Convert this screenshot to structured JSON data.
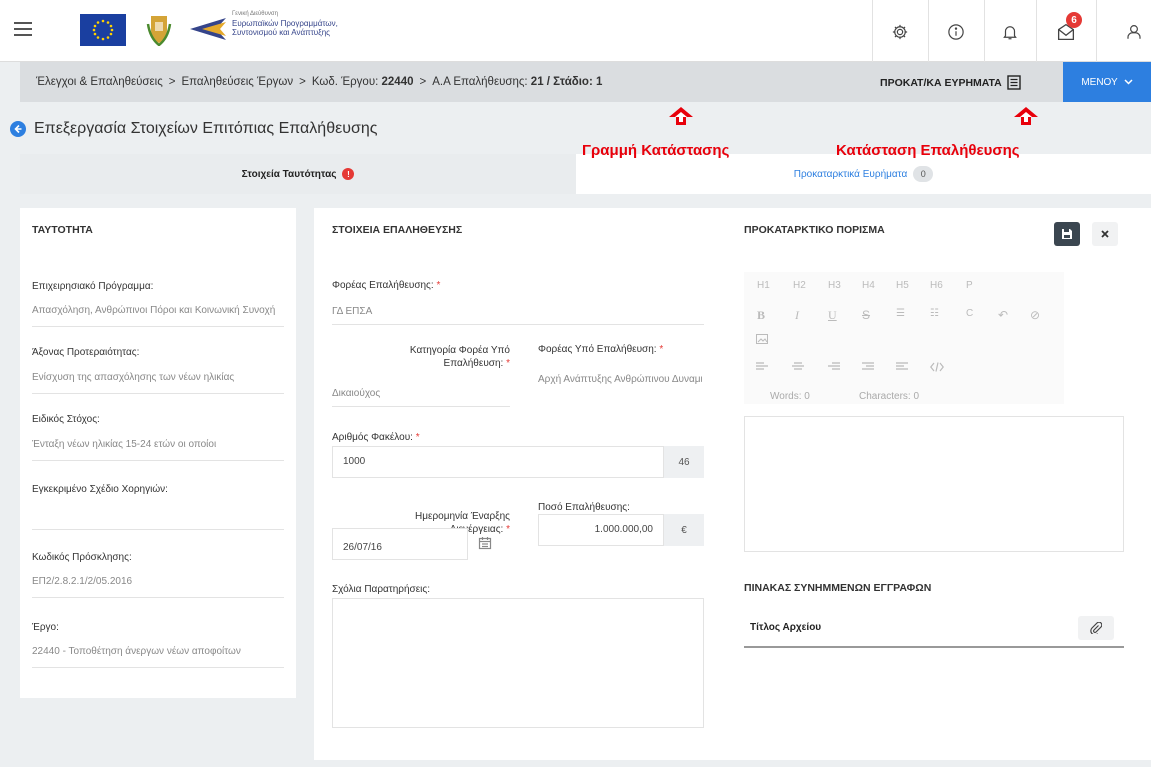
{
  "header": {
    "logo_text_line1": "Γενική Διεύθυνση",
    "logo_text_line2": "Ευρωπαϊκών Προγραμμάτων,",
    "logo_text_line3": "Συντονισμού και Ανάπτυξης",
    "mail_count": "6",
    "icons": [
      "gear-icon",
      "info-icon",
      "bell-icon",
      "mail-icon",
      "user-icon"
    ]
  },
  "breadcrumb": {
    "c1": "Έλεγχοι & Επαληθεύσεις",
    "c2": "Επαληθεύσεις Έργων",
    "c3_label": "Κωδ. Έργου:",
    "c3_value": "22440",
    "c4_label": "Α.Α Επαλήθευσης:",
    "c4_value": "21 / Στάδιο: 1",
    "separator": ">",
    "prelim_label": "ΠΡΟΚΑΤ/ΚΑ ΕΥΡΗΜΑΤΑ",
    "menu_label": "ΜΕΝΟΥ"
  },
  "page": {
    "title": "Επεξεργασία Στοιχείων Επιτόπιας Επαλήθευσης"
  },
  "annotations": {
    "status_line": "Γραμμή Κατάστασης",
    "verification_status": "Κατάσταση Επαλήθευσης"
  },
  "tabs": {
    "identity": "Στοιχεία Ταυτότητας",
    "identity_error": "!",
    "findings": "Προκαταρκτικά Ευρήματα",
    "findings_count": "0"
  },
  "identity_panel": {
    "title": "ΤΑΥΤΟΤΗΤΑ",
    "op_label": "Επιχειρησιακό Πρόγραμμα:",
    "op_value": "Απασχόληση, Ανθρώπινοι Πόροι και Κοινωνική Συνοχή",
    "axis_label": "Άξονας Προτεραιότητας:",
    "axis_value": "Ενίσχυση της απασχόλησης των νέων ηλικίας",
    "goal_label": "Ειδικός Στόχος:",
    "goal_value": "Ένταξη νέων ηλικίας 15-24 ετών οι οποίοι",
    "plan_label": "Εγκεκριμένο Σχέδιο Χορηγιών:",
    "plan_value": "",
    "call_label": "Κωδικός Πρόσκλησης:",
    "call_value": "ΕΠ2/2.8.2.1/2/05.2016",
    "project_label": "Έργο:",
    "project_value": "22440 - Τοποθέτηση άνεργων νέων αποφοίτων"
  },
  "verification": {
    "title": "ΣΤΟΙΧΕΙΑ ΕΠΑΛΗΘΕΥΣΗΣ",
    "body_label": "Φορέας Επαλήθευσης:",
    "body_value": "ΓΔ ΕΠΣΑ",
    "cat_label_1": "Κατηγορία Φορέα Υπό",
    "cat_label_2": "Επαλήθευση:",
    "cat_value": "Δικαιούχος",
    "under_label": "Φορέας Υπό Επαλήθευση:",
    "under_value": "Αρχή Ανάπτυξης Ανθρώπινου Δυναμικού",
    "file_label": "Αριθμός Φακέλου:",
    "file_value": "1000",
    "file_counter": "46",
    "date_label_1": "Ημερομηνία Έναρξης",
    "date_label_2": "Διενέργειας:",
    "date_value": "26/07/16",
    "amount_label": "Ποσό Επαλήθευσης:",
    "amount_value": "1.000.000,00",
    "currency": "€",
    "comments_label": "Σχόλια Παρατηρήσεις:",
    "required_mark": "*"
  },
  "conclusion": {
    "title": "ΠΡΟΚΑΤΑΡΚΤΙΚΟ ΠΟΡΙΣΜΑ",
    "toolbar_row1": [
      "H1",
      "H2",
      "H3",
      "H4",
      "H5",
      "H6",
      "P"
    ],
    "toolbar_row2": [
      "B",
      "I",
      "U",
      "S",
      "☰",
      "☷",
      "C",
      "↶",
      "⊘"
    ],
    "words": "Words: 0",
    "characters": "Characters: 0"
  },
  "attachments": {
    "title": "ΠΙΝΑΚΑΣ ΣΥΝΗΜΜΕΝΩΝ ΕΓΓΡΑΦΩΝ",
    "col_title": "Τίτλος Αρχείου"
  },
  "colors": {
    "accent": "#2d7fe0",
    "annotation_red": "#e8000b",
    "error_red": "#e53935"
  }
}
